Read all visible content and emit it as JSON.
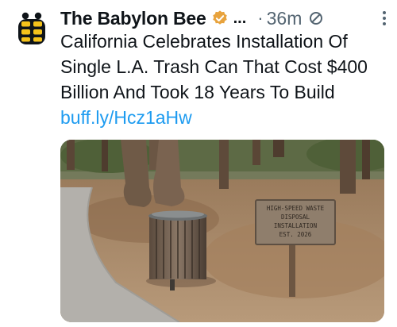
{
  "tweet": {
    "author_name": "The Babylon Bee",
    "name_truncation": "...",
    "separator": "·",
    "timestamp": "36m",
    "text": "California Celebrates Installation Of Single L.A. Trash Can That Cost $400 Billion And Took 18 Years To Build",
    "link_text": "buff.ly/Hcz1aHw"
  },
  "image": {
    "sign_lines": [
      "HIGH-SPEED WASTE",
      "DISPOSAL",
      "INSTALLATION",
      "EST. 2026"
    ]
  },
  "colors": {
    "link": "#1d9bf0",
    "badge": "#e8a33d",
    "muted": "#536471",
    "avatar_yellow": "#f4c21b"
  },
  "icons": [
    "bee-logo-icon",
    "verified-badge-icon",
    "not-allowed-icon",
    "more-options-icon"
  ]
}
